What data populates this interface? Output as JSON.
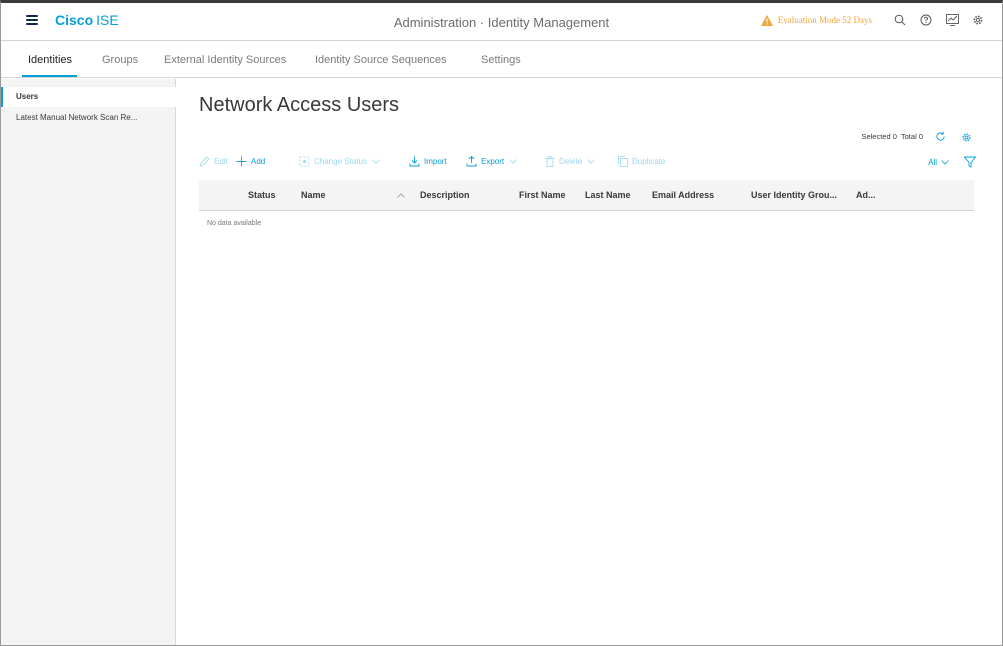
{
  "header": {
    "brand_bold": "Cisco",
    "brand_light": "ISE",
    "title": "Administration · Identity Management",
    "eval_text": "Evaluation Mode 52 Days",
    "colors": {
      "accent": "#049fd9",
      "warning": "#f2a33a"
    }
  },
  "tabs": [
    {
      "label": "Identities"
    },
    {
      "label": "Groups"
    },
    {
      "label": "External Identity Sources"
    },
    {
      "label": "Identity Source Sequences"
    },
    {
      "label": "Settings"
    }
  ],
  "sidebar": {
    "items": [
      {
        "label": "Users"
      },
      {
        "label": "Latest Manual Network Scan Re..."
      }
    ]
  },
  "main": {
    "title": "Network Access Users",
    "selected_label": "Selected 0",
    "total_label": "Total 0",
    "toolbar": {
      "edit": "Edit",
      "add": "Add",
      "change_status": "Change Status",
      "import": "Import",
      "export": "Export",
      "delete": "Delete",
      "duplicate": "Duplicate"
    },
    "filter_label": "All",
    "columns": [
      "Status",
      "Name",
      "Description",
      "First Name",
      "Last Name",
      "Email Address",
      "User Identity Grou...",
      "Ad..."
    ],
    "empty_text": "No data available"
  }
}
